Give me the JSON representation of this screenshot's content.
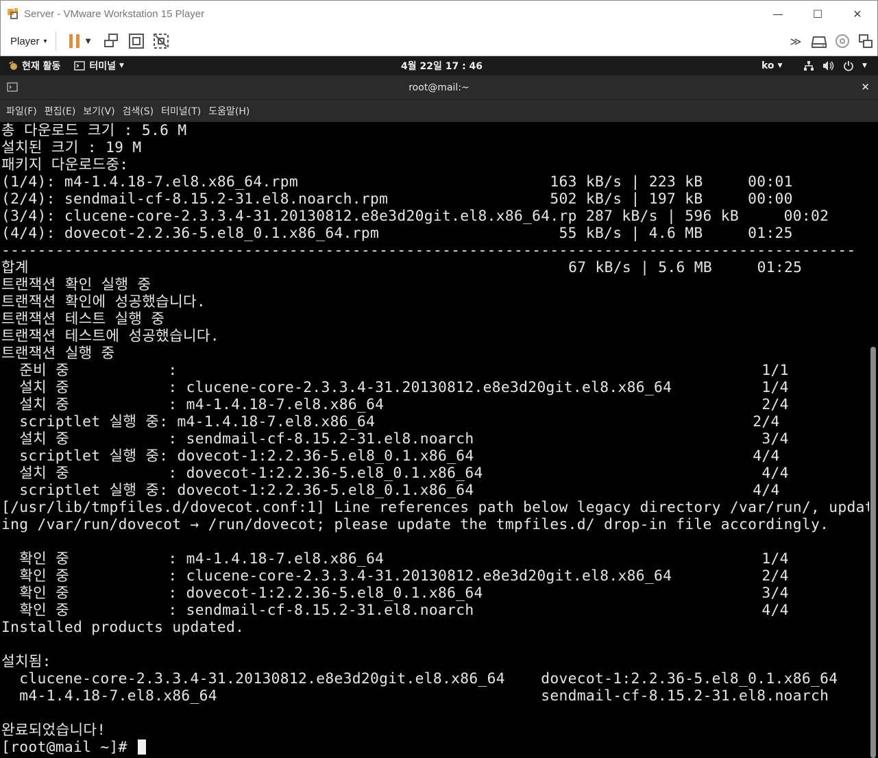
{
  "window": {
    "title": "Server - VMware Workstation 15 Player",
    "minimize": "—",
    "maximize": "☐",
    "close": "✕"
  },
  "toolbar": {
    "player_label": "Player",
    "player_caret": "▾"
  },
  "gnome": {
    "activities": "현재 활동",
    "app_menu": "터미널",
    "clock": "4월 22일  17 : 46",
    "lang": "ko"
  },
  "terminal": {
    "title": "root@mail:~",
    "close": "✕",
    "menu": [
      "파일(F)",
      "편집(E)",
      "보기(V)",
      "검색(S)",
      "터미널(T)",
      "도움말(H)"
    ],
    "lines": [
      "총 다운로드 크기 : 5.6 M",
      "설치된 크기 : 19 M",
      "패키지 다운로드중:",
      "(1/4): m4-1.4.18-7.el8.x86_64.rpm                            163 kB/s | 223 kB     00:01",
      "(2/4): sendmail-cf-8.15.2-31.el8.noarch.rpm                  502 kB/s | 197 kB     00:00",
      "(3/4): clucene-core-2.3.3.4-31.20130812.e8e3d20git.el8.x86_64.rp 287 kB/s | 596 kB     00:02",
      "(4/4): dovecot-2.2.36-5.el8_0.1.x86_64.rpm                    55 kB/s | 4.6 MB     01:25",
      "-----------------------------------------------------------------------------------------------",
      "합계                                                            67 kB/s | 5.6 MB     01:25",
      "트랜잭션 확인 실행 중",
      "트랜잭션 확인에 성공했습니다.",
      "트랜잭션 테스트 실행 중",
      "트랜잭션 테스트에 성공했습니다.",
      "트랜잭션 실행 중",
      "  준비 중           :                                                                 1/1",
      "  설치 중           : clucene-core-2.3.3.4-31.20130812.e8e3d20git.el8.x86_64          1/4",
      "  설치 중           : m4-1.4.18-7.el8.x86_64                                          2/4",
      "  scriptlet 실행 중: m4-1.4.18-7.el8.x86_64                                          2/4",
      "  설치 중           : sendmail-cf-8.15.2-31.el8.noarch                                3/4",
      "  scriptlet 실행 중: dovecot-1:2.2.36-5.el8_0.1.x86_64                               4/4",
      "  설치 중           : dovecot-1:2.2.36-5.el8_0.1.x86_64                               4/4",
      "  scriptlet 실행 중: dovecot-1:2.2.36-5.el8_0.1.x86_64                               4/4",
      "[/usr/lib/tmpfiles.d/dovecot.conf:1] Line references path below legacy directory /var/run/, updat",
      "ing /var/run/dovecot → /run/dovecot; please update the tmpfiles.d/ drop-in file accordingly.",
      "",
      "  확인 중           : m4-1.4.18-7.el8.x86_64                                          1/4",
      "  확인 중           : clucene-core-2.3.3.4-31.20130812.e8e3d20git.el8.x86_64          2/4",
      "  확인 중           : dovecot-1:2.2.36-5.el8_0.1.x86_64                               3/4",
      "  확인 중           : sendmail-cf-8.15.2-31.el8.noarch                                4/4",
      "Installed products updated.",
      "",
      "설치됨:",
      "  clucene-core-2.3.3.4-31.20130812.e8e3d20git.el8.x86_64    dovecot-1:2.2.36-5.el8_0.1.x86_64",
      "  m4-1.4.18-7.el8.x86_64                                    sendmail-cf-8.15.2-31.el8.noarch",
      "",
      "완료되었습니다!"
    ],
    "prompt": "[root@mail ~]# "
  }
}
